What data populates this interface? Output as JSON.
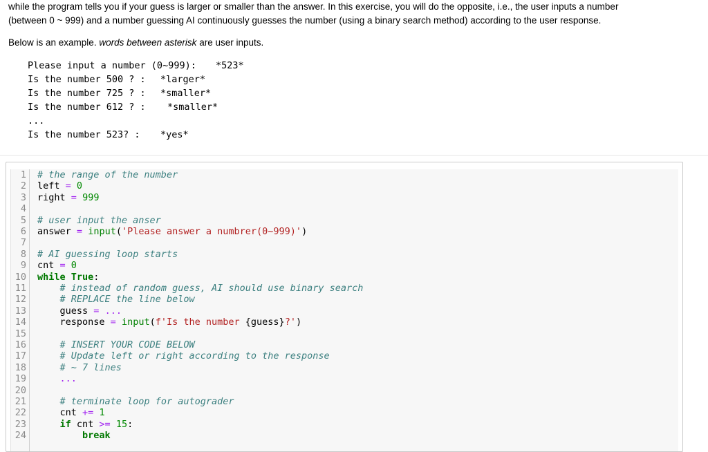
{
  "intro": {
    "line1": "while the program tells you if your guess is larger or smaller than the answer. In this exercise, you will do the opposite, i.e., the user inputs a number",
    "line2": "(between 0 ~ 999) and a number guessing AI continuously guesses the number (using a binary search method) according to the user response."
  },
  "example": {
    "lead": "Below is an example.",
    "emph": "words between asterisk",
    "tail": "are user inputs."
  },
  "console": [
    {
      "prompt": "Please input a number (0~999):",
      "answer": "*523*"
    },
    {
      "prompt": "Is the number 500 ? :",
      "answer": "*larger*"
    },
    {
      "prompt": "Is the number 725 ? :",
      "answer": "*smaller*"
    },
    {
      "prompt": "Is the number 612 ? :",
      "answer": "*smaller*"
    },
    {
      "prompt": "...",
      "answer": ""
    },
    {
      "prompt": "Is the number 523? :",
      "answer": "*yes*"
    }
  ],
  "code_lines": [
    [
      {
        "t": "cm",
        "v": "# the range of the number"
      }
    ],
    [
      {
        "t": "plain",
        "v": "left "
      },
      {
        "t": "op",
        "v": "="
      },
      {
        "t": "plain",
        "v": " "
      },
      {
        "t": "num",
        "v": "0"
      }
    ],
    [
      {
        "t": "plain",
        "v": "right "
      },
      {
        "t": "op",
        "v": "="
      },
      {
        "t": "plain",
        "v": " "
      },
      {
        "t": "num",
        "v": "999"
      }
    ],
    [],
    [
      {
        "t": "cm",
        "v": "# user input the anser"
      }
    ],
    [
      {
        "t": "plain",
        "v": "answer "
      },
      {
        "t": "op",
        "v": "="
      },
      {
        "t": "plain",
        "v": " "
      },
      {
        "t": "fn",
        "v": "input"
      },
      {
        "t": "plain",
        "v": "("
      },
      {
        "t": "str",
        "v": "'Please answer a numbrer(0~999)'"
      },
      {
        "t": "plain",
        "v": ")"
      }
    ],
    [],
    [
      {
        "t": "cm",
        "v": "# AI guessing loop starts"
      }
    ],
    [
      {
        "t": "plain",
        "v": "cnt "
      },
      {
        "t": "op",
        "v": "="
      },
      {
        "t": "plain",
        "v": " "
      },
      {
        "t": "num",
        "v": "0"
      }
    ],
    [
      {
        "t": "kw",
        "v": "while"
      },
      {
        "t": "plain",
        "v": " "
      },
      {
        "t": "kw",
        "v": "True"
      },
      {
        "t": "plain",
        "v": ":"
      }
    ],
    [
      {
        "t": "plain",
        "v": "    "
      },
      {
        "t": "cm",
        "v": "# instead of random guess, AI should use binary search"
      }
    ],
    [
      {
        "t": "plain",
        "v": "    "
      },
      {
        "t": "cm",
        "v": "# REPLACE the line below"
      }
    ],
    [
      {
        "t": "plain",
        "v": "    guess "
      },
      {
        "t": "op",
        "v": "="
      },
      {
        "t": "plain",
        "v": " "
      },
      {
        "t": "op",
        "v": "..."
      }
    ],
    [
      {
        "t": "plain",
        "v": "    response "
      },
      {
        "t": "op",
        "v": "="
      },
      {
        "t": "plain",
        "v": " "
      },
      {
        "t": "fn",
        "v": "input"
      },
      {
        "t": "plain",
        "v": "("
      },
      {
        "t": "str",
        "v": "f'Is the number "
      },
      {
        "t": "plain",
        "v": "{guess}"
      },
      {
        "t": "str",
        "v": "?'"
      },
      {
        "t": "plain",
        "v": ")"
      }
    ],
    [],
    [
      {
        "t": "plain",
        "v": "    "
      },
      {
        "t": "cm",
        "v": "# INSERT YOUR CODE BELOW"
      }
    ],
    [
      {
        "t": "plain",
        "v": "    "
      },
      {
        "t": "cm",
        "v": "# Update left or right according to the response"
      }
    ],
    [
      {
        "t": "plain",
        "v": "    "
      },
      {
        "t": "cm",
        "v": "# ~ 7 lines"
      }
    ],
    [
      {
        "t": "plain",
        "v": "    "
      },
      {
        "t": "op",
        "v": "..."
      }
    ],
    [],
    [
      {
        "t": "plain",
        "v": "    "
      },
      {
        "t": "cm",
        "v": "# terminate loop for autograder"
      }
    ],
    [
      {
        "t": "plain",
        "v": "    cnt "
      },
      {
        "t": "op",
        "v": "+="
      },
      {
        "t": "plain",
        "v": " "
      },
      {
        "t": "num",
        "v": "1"
      }
    ],
    [
      {
        "t": "plain",
        "v": "    "
      },
      {
        "t": "kw",
        "v": "if"
      },
      {
        "t": "plain",
        "v": " cnt "
      },
      {
        "t": "op",
        "v": ">="
      },
      {
        "t": "plain",
        "v": " "
      },
      {
        "t": "num",
        "v": "15"
      },
      {
        "t": "plain",
        "v": ":"
      }
    ],
    [
      {
        "t": "plain",
        "v": "        "
      },
      {
        "t": "kw",
        "v": "break"
      }
    ]
  ]
}
